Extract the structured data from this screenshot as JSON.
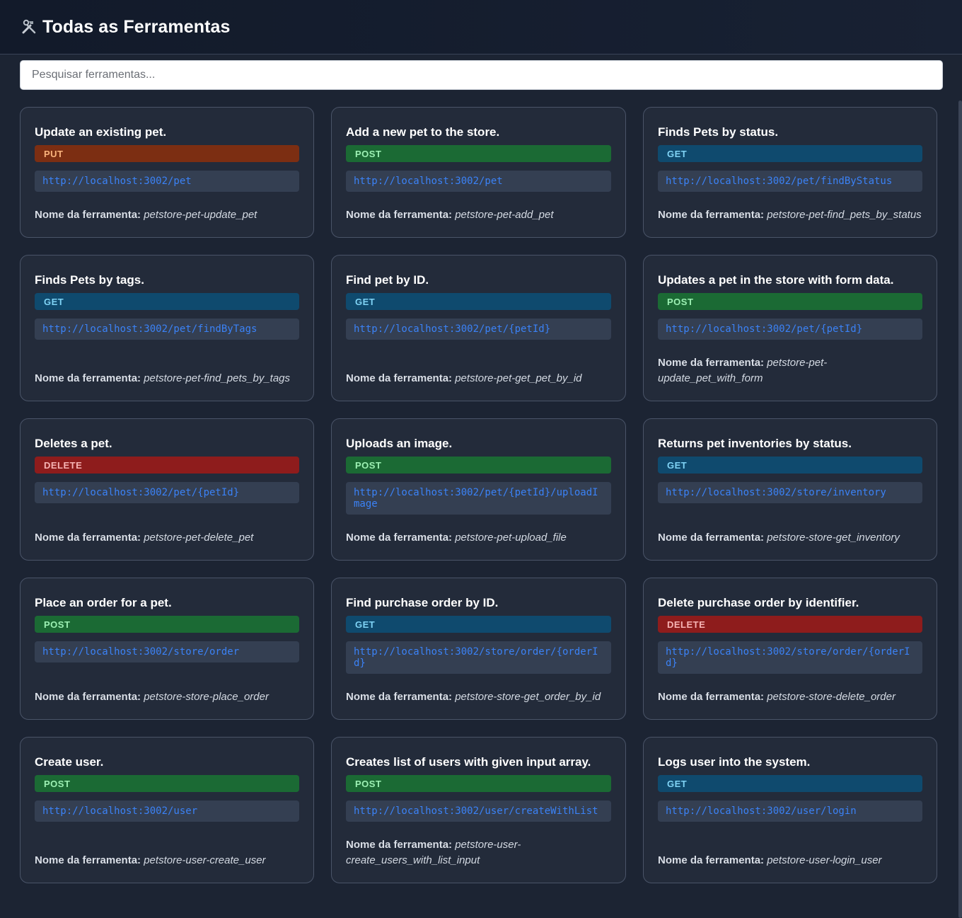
{
  "header": {
    "icon": "hammer-wrench-icon",
    "title": "Todas as Ferramentas"
  },
  "search": {
    "placeholder": "Pesquisar ferramentas..."
  },
  "colors": {
    "GET": "#0f4a6e",
    "POST": "#1b6a34",
    "PUT": "#7c2e12",
    "DELETE": "#8e1c1c",
    "url": "#3b82f6",
    "card_bg": "#232b3a",
    "page_bg": "#1c2433"
  },
  "tool_name_label": "Nome da ferramenta:",
  "tools": [
    {
      "title": "Update an existing pet.",
      "method": "PUT",
      "url": "http://localhost:3002/pet",
      "name": "petstore-pet-update_pet"
    },
    {
      "title": "Add a new pet to the store.",
      "method": "POST",
      "url": "http://localhost:3002/pet",
      "name": "petstore-pet-add_pet"
    },
    {
      "title": "Finds Pets by status.",
      "method": "GET",
      "url": "http://localhost:3002/pet/findByStatus",
      "name": "petstore-pet-find_pets_by_status"
    },
    {
      "title": "Finds Pets by tags.",
      "method": "GET",
      "url": "http://localhost:3002/pet/findByTags",
      "name": "petstore-pet-find_pets_by_tags"
    },
    {
      "title": "Find pet by ID.",
      "method": "GET",
      "url": "http://localhost:3002/pet/{petId}",
      "name": "petstore-pet-get_pet_by_id"
    },
    {
      "title": "Updates a pet in the store with form data.",
      "method": "POST",
      "url": "http://localhost:3002/pet/{petId}",
      "name": "petstore-pet-update_pet_with_form"
    },
    {
      "title": "Deletes a pet.",
      "method": "DELETE",
      "url": "http://localhost:3002/pet/{petId}",
      "name": "petstore-pet-delete_pet"
    },
    {
      "title": "Uploads an image.",
      "method": "POST",
      "url": "http://localhost:3002/pet/{petId}/uploadImage",
      "name": "petstore-pet-upload_file"
    },
    {
      "title": "Returns pet inventories by status.",
      "method": "GET",
      "url": "http://localhost:3002/store/inventory",
      "name": "petstore-store-get_inventory"
    },
    {
      "title": "Place an order for a pet.",
      "method": "POST",
      "url": "http://localhost:3002/store/order",
      "name": "petstore-store-place_order"
    },
    {
      "title": "Find purchase order by ID.",
      "method": "GET",
      "url": "http://localhost:3002/store/order/{orderId}",
      "name": "petstore-store-get_order_by_id"
    },
    {
      "title": "Delete purchase order by identifier.",
      "method": "DELETE",
      "url": "http://localhost:3002/store/order/{orderId}",
      "name": "petstore-store-delete_order"
    },
    {
      "title": "Create user.",
      "method": "POST",
      "url": "http://localhost:3002/user",
      "name": "petstore-user-create_user"
    },
    {
      "title": "Creates list of users with given input array.",
      "method": "POST",
      "url": "http://localhost:3002/user/createWithList",
      "name": "petstore-user-create_users_with_list_input"
    },
    {
      "title": "Logs user into the system.",
      "method": "GET",
      "url": "http://localhost:3002/user/login",
      "name": "petstore-user-login_user"
    }
  ]
}
